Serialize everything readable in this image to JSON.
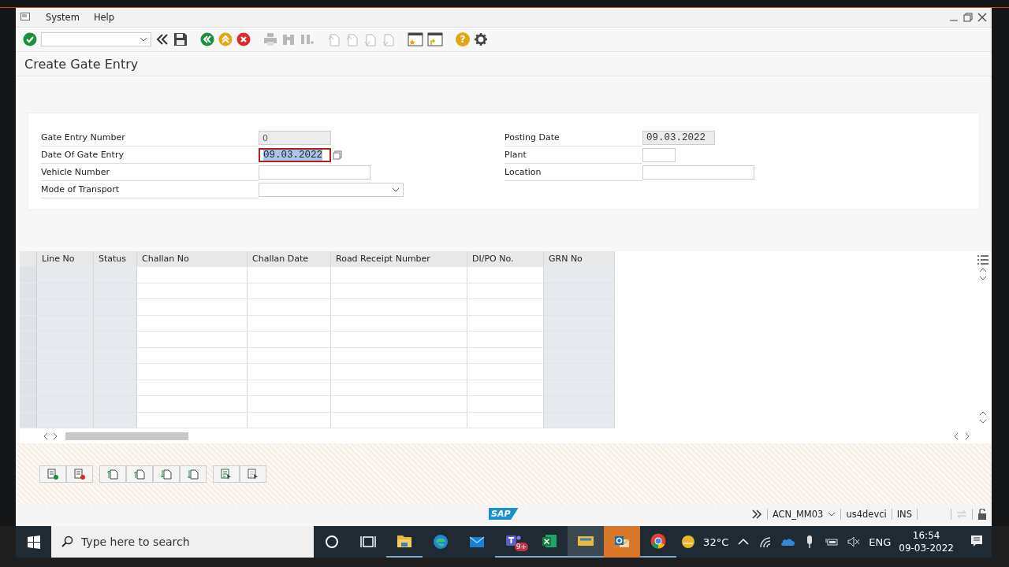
{
  "menu": [
    {
      "label": "System"
    },
    {
      "label": "Help"
    }
  ],
  "toolbar": {
    "help_glyph": "?"
  },
  "title": "Create Gate Entry",
  "header_fields": {
    "left": [
      {
        "label": "Gate Entry Number",
        "kind": "readonly",
        "value": "0",
        "focused": false
      },
      {
        "label": "Date Of Gate Entry",
        "kind": "date",
        "value": "09.03.2022",
        "focused": true
      },
      {
        "label": "Vehicle Number",
        "kind": "input",
        "focused": false
      },
      {
        "label": "Mode of Transport",
        "kind": "dropdown",
        "focused": false
      }
    ],
    "right": [
      {
        "label": "Posting Date",
        "kind": "readonly",
        "value": "09.03.2022",
        "focused": false
      },
      {
        "label": "Plant",
        "kind": "short",
        "focused": false
      },
      {
        "label": "Location",
        "kind": "input",
        "focused": false
      }
    ]
  },
  "table": {
    "columns": [
      {
        "label": "Line No",
        "editable": false
      },
      {
        "label": "Status",
        "editable": false
      },
      {
        "label": "Challan No",
        "editable": true
      },
      {
        "label": "Challan Date",
        "editable": true
      },
      {
        "label": "Road Receipt Number",
        "editable": true
      },
      {
        "label": "DI/PO No.",
        "editable": true
      },
      {
        "label": "GRN No",
        "editable": false
      }
    ]
  },
  "status_bar": {
    "logo": "SAP",
    "transaction": "ACN_MM03",
    "system": "us4devci",
    "mode": "INS"
  },
  "taskbar": {
    "search_placeholder": "Type here to search",
    "apps": [
      {
        "kind": "cortana",
        "selected": false,
        "flashing": false,
        "running": false
      },
      {
        "kind": "taskview",
        "selected": false,
        "flashing": false,
        "running": false
      },
      {
        "kind": "files",
        "selected": false,
        "flashing": false,
        "running": true
      },
      {
        "kind": "edge",
        "selected": false,
        "flashing": false,
        "running": false
      },
      {
        "kind": "mail",
        "selected": false,
        "flashing": false,
        "running": false
      },
      {
        "kind": "teams",
        "selected": false,
        "flashing": false,
        "running": true,
        "badge": "9+"
      },
      {
        "kind": "excel",
        "selected": false,
        "flashing": false,
        "running": true
      },
      {
        "kind": "sap",
        "selected": true,
        "flashing": false,
        "running": true
      },
      {
        "kind": "outlook",
        "selected": false,
        "flashing": true,
        "running": false
      },
      {
        "kind": "chrome",
        "selected": false,
        "flashing": false,
        "running": true
      }
    ],
    "weather": "32°C",
    "language": "ENG",
    "time": "16:54",
    "date": "09-03-2022"
  }
}
